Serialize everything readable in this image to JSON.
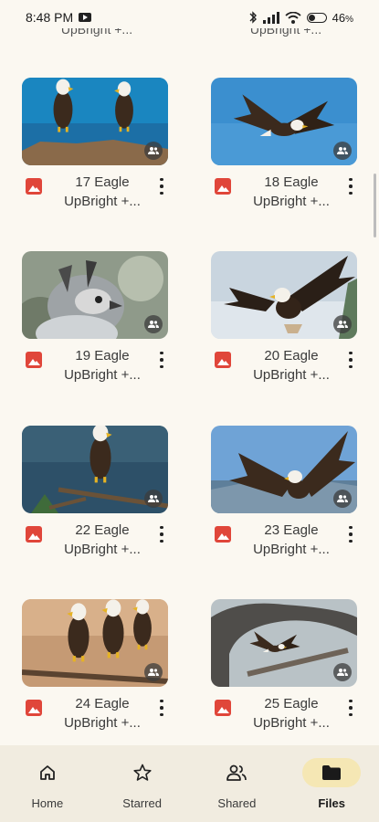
{
  "status_bar": {
    "time": "8:48 PM",
    "battery": "46",
    "battery_fraction": 0.46
  },
  "cutoff_captions": [
    "UpBright +...",
    "UpBright +..."
  ],
  "files": [
    {
      "line1": "17 Eagle",
      "line2": "UpBright +...",
      "scene": "two-perched"
    },
    {
      "line1": "18 Eagle",
      "line2": "UpBright +...",
      "scene": "flying-sky"
    },
    {
      "line1": "19 Eagle",
      "line2": "UpBright +...",
      "scene": "harpy"
    },
    {
      "line1": "20 Eagle",
      "line2": "UpBright +...",
      "scene": "landing"
    },
    {
      "line1": "22 Eagle",
      "line2": "UpBright +...",
      "scene": "perched-branch"
    },
    {
      "line1": "23 Eagle",
      "line2": "UpBright +...",
      "scene": "wings-spread"
    },
    {
      "line1": "24 Eagle",
      "line2": "UpBright +...",
      "scene": "two-on-branch"
    },
    {
      "line1": "25 Eagle",
      "line2": "UpBright +...",
      "scene": "under-arch"
    }
  ],
  "nav": [
    {
      "label": "Home",
      "icon": "home-icon",
      "active": false
    },
    {
      "label": "Starred",
      "icon": "star-icon",
      "active": false
    },
    {
      "label": "Shared",
      "icon": "shared-icon",
      "active": false
    },
    {
      "label": "Files",
      "icon": "folder-icon",
      "active": true
    }
  ]
}
